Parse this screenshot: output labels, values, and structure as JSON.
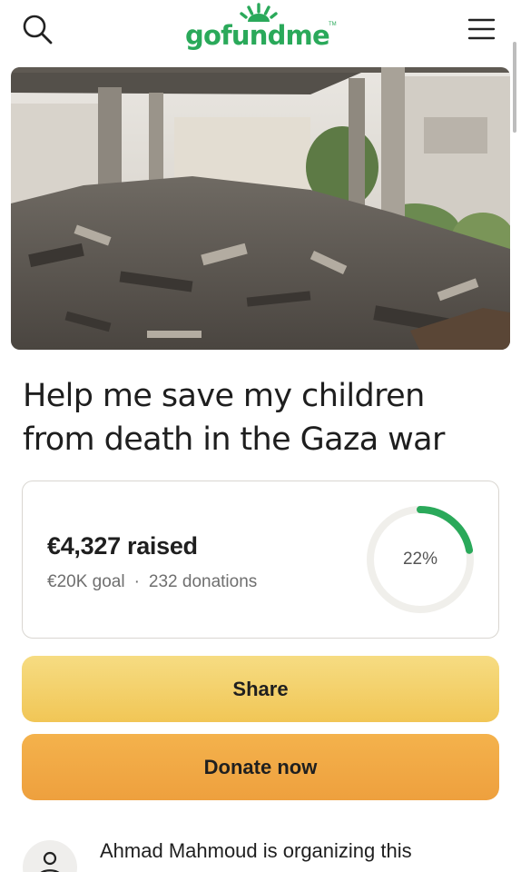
{
  "header": {
    "logo_text": "gofundme",
    "logo_tm": "TM",
    "search_icon": "search-icon",
    "menu_icon": "hamburger-menu-icon",
    "brand_color": "#2aa95a"
  },
  "hero": {
    "image": "photo of a destroyed building with rubble"
  },
  "campaign": {
    "title": "Help me save my children from death in the Gaza war",
    "raised_label": "€4,327 raised",
    "goal_label": "€20K goal",
    "separator": "·",
    "donations_label": "232 donations",
    "progress_label": "22%",
    "progress_fraction": 0.22,
    "progress_color": "#2aa95a"
  },
  "actions": {
    "share_label": "Share",
    "donate_label": "Donate now"
  },
  "organizer": {
    "text": "Ahmad Mahmoud is organizing this",
    "avatar_icon": "user-icon"
  }
}
